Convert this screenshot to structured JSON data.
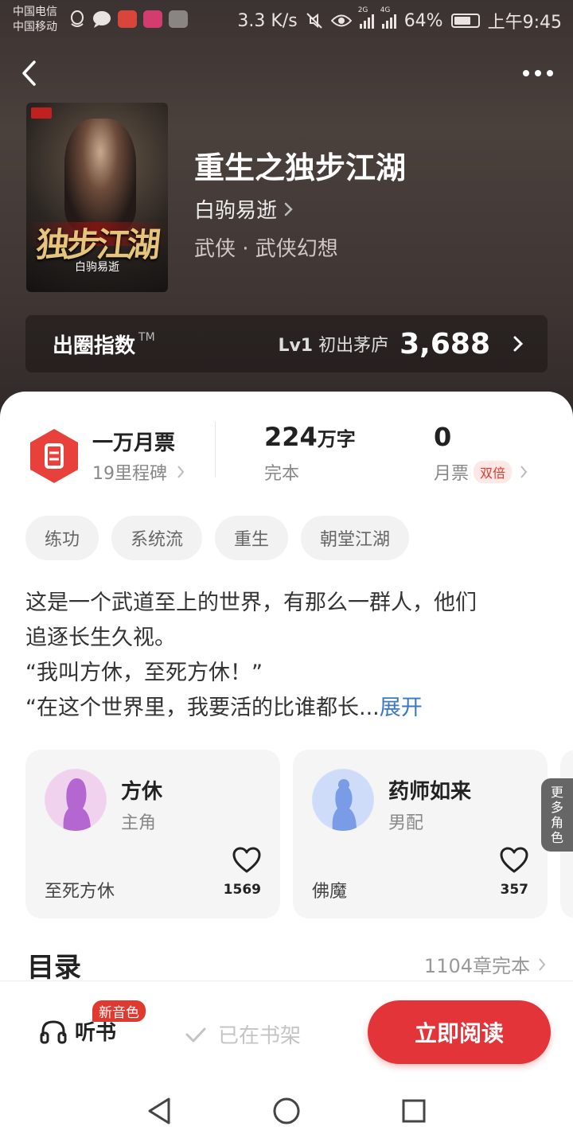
{
  "status_bar": {
    "carrier_1": "中国电信",
    "carrier_2": "中国移动",
    "speed": "3.3 K/s",
    "net_1": "2G",
    "net_2": "4G",
    "battery": "64%",
    "time": "上午9:45"
  },
  "book": {
    "title": "重生之独步江湖",
    "author": "白驹易逝",
    "genre": "武侠 · 武侠幻想",
    "cover_title": "独步江湖",
    "cover_author": "白驹易逝"
  },
  "index_card": {
    "label": "出圈指数",
    "tm": "TM",
    "level_code": "Lv1",
    "level_name": "初出茅庐",
    "value": "3,688"
  },
  "stats": {
    "ticket_title": "一万月票",
    "ticket_sub": "19里程碑",
    "words_value": "224",
    "words_unit": "万字",
    "words_status": "完本",
    "votes_value": "0",
    "votes_label": "月票",
    "votes_badge": "双倍"
  },
  "tags": [
    "练功",
    "系统流",
    "重生",
    "朝堂江湖"
  ],
  "synopsis": {
    "line_1": "这是一个武道至上的世界，有那么一群人，他们",
    "line_2": "追逐长生久视。",
    "line_3": "“我叫方休，至死方休！”",
    "line_4": "“在这个世界里，我要活的比谁都长...",
    "expand": "展开"
  },
  "roles": [
    {
      "name": "方休",
      "type": "主角",
      "quote": "至死方休",
      "likes": "1569"
    },
    {
      "name": "药师如来",
      "type": "男配",
      "quote": "佛魔",
      "likes": "357"
    }
  ],
  "more_roles": "更多角色",
  "toc": {
    "title": "目录",
    "info": "1104章完本"
  },
  "bottom_bar": {
    "listen": "听书",
    "new_voice": "新音色",
    "shelf": "已在书架",
    "read": "立即阅读"
  },
  "colors": {
    "accent_red": "#e3343a",
    "link_blue": "#3a78c7",
    "hero_bg": "#3f3634"
  }
}
